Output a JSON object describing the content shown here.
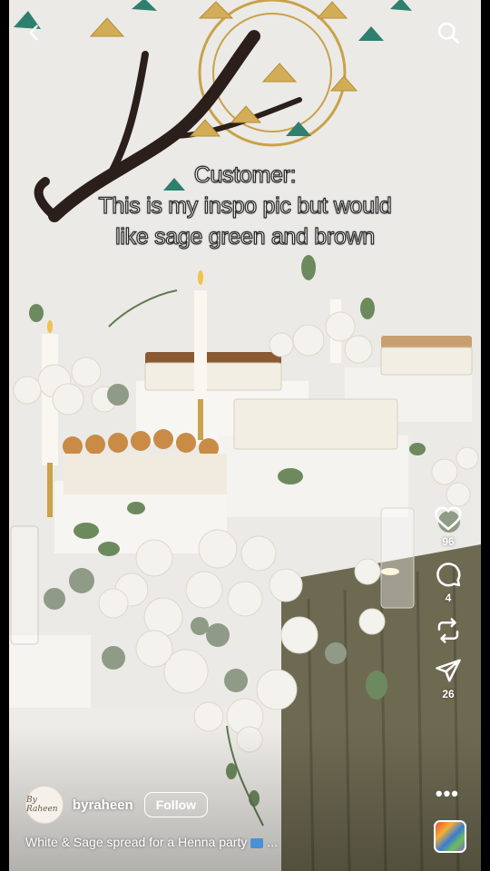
{
  "overlay": {
    "caption_line1": "Customer:",
    "caption_line2": "This is my inspo pic but would",
    "caption_line3": "like sage green and brown"
  },
  "nav": {
    "back_icon": "chevron-left-icon",
    "search_icon": "search-icon"
  },
  "actions": {
    "like_count": "96",
    "comment_count": "4",
    "share_count": "26"
  },
  "post": {
    "username": "byraheen",
    "follow_label": "Follow",
    "avatar_text": "By Raheen",
    "description": "White & Sage spread for a Henna party",
    "description_ellipsis": "..."
  },
  "colors": {
    "sage": "#7a7a5c",
    "drape": "#6e6a52",
    "gold": "#c9a24a",
    "branch": "#2a1f1a",
    "teal_leaf": "#2f7f6f"
  }
}
